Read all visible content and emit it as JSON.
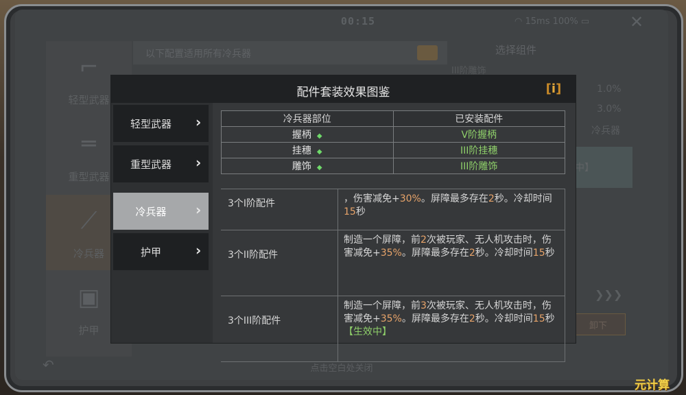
{
  "status_bar": {
    "time": "00:15",
    "network": "15ms",
    "battery": "100%"
  },
  "background": {
    "left_tabs": [
      {
        "label": "轻型武器",
        "icon": "smg-icon"
      },
      {
        "label": "重型武器",
        "icon": "launcher-icon"
      },
      {
        "label": "冷兵器",
        "icon": "knife-icon"
      },
      {
        "label": "护甲",
        "icon": "armor-icon"
      }
    ],
    "top_text": "以下配置适用所有冷兵器",
    "right_title": "选择组件",
    "right_sub": "III阶雕饰",
    "right_values": [
      "1.0%",
      "3.0%",
      "冷兵器"
    ],
    "right_box_text": "中】",
    "right_button": "卸下",
    "bottom_hint": "点击空白处关闭"
  },
  "modal": {
    "title": "配件套装效果图鉴",
    "info_label": "i",
    "nav": [
      {
        "label": "轻型武器"
      },
      {
        "label": "重型武器"
      },
      {
        "label": "冷兵器"
      },
      {
        "label": "护甲"
      }
    ],
    "active_nav": "冷兵器",
    "parts_table": {
      "headers": [
        "冷兵器部位",
        "已安装配件"
      ],
      "rows": [
        {
          "part": "握柄",
          "installed": "V阶握柄"
        },
        {
          "part": "挂穗",
          "installed": "III阶挂穗"
        },
        {
          "part": "雕饰",
          "installed": "III阶雕饰"
        }
      ]
    },
    "bonus_table": [
      {
        "tier": "3个I阶配件",
        "desc": {
          "a": "，伤害减免+",
          "b": "30%",
          "c": "。屏障最多存在",
          "d": "2",
          "e": "秒。冷却时间",
          "f": "15",
          "g": "秒"
        }
      },
      {
        "tier": "3个II阶配件",
        "desc": {
          "a": "制造一个屏障，前",
          "b": "2",
          "c": "次被玩家、无人机攻击时，伤害减免+",
          "d": "35%",
          "e": "。屏障最多存在",
          "f": "2",
          "g": "秒。冷却时间",
          "h": "15",
          "i": "秒"
        }
      },
      {
        "tier": "3个III阶配件",
        "desc": {
          "a": "制造一个屏障，前",
          "b": "3",
          "c": "次被玩家、无人机攻击时，伤害减免+",
          "d": "35%",
          "e": "。屏障最多存在",
          "f": "2",
          "g": "秒。冷却时间",
          "h": "15",
          "i": "秒",
          "active": "【生效中】"
        }
      }
    ]
  },
  "watermark": "元计算",
  "colors": {
    "accent": "#e3a83a",
    "highlight": "#e8a46a",
    "green": "#8fd06a"
  }
}
